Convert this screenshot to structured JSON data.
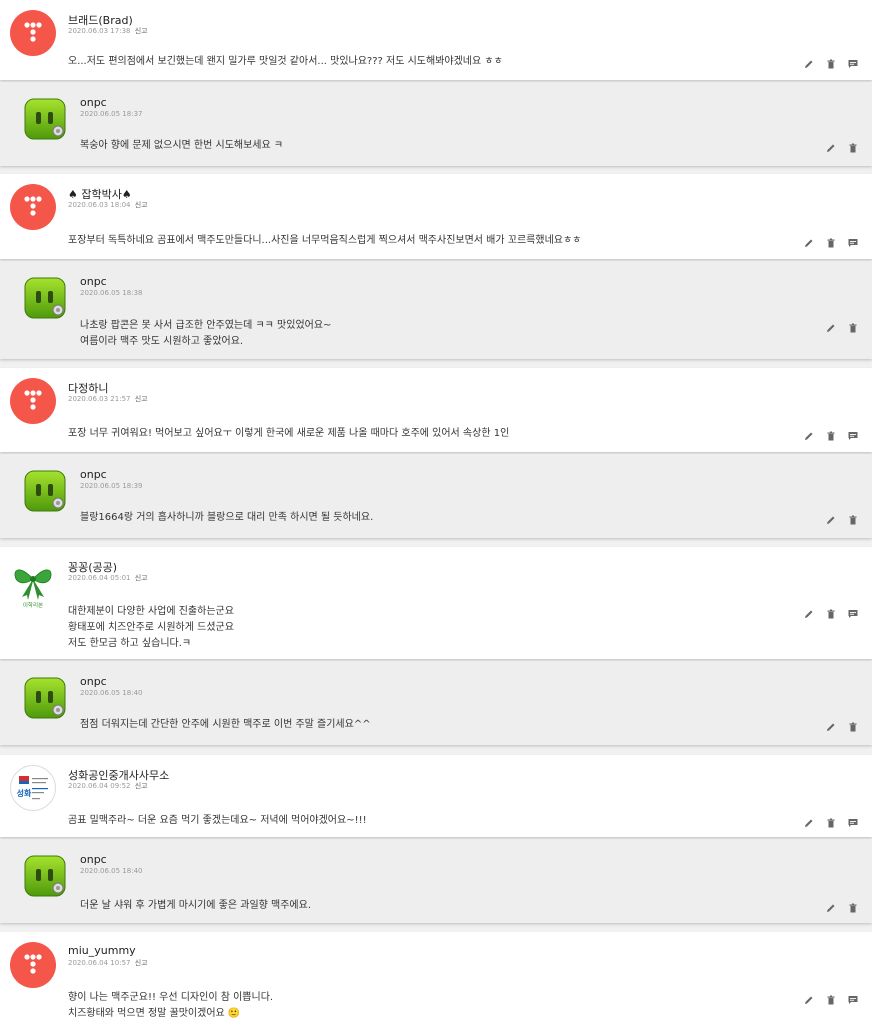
{
  "comments": [
    {
      "author": "브래드(Brad)",
      "date": "2020.06.03 17:38",
      "report": "신고",
      "avatar": "red-dots",
      "lines": [
        "오...저도 편의점에서 보긴했는데 왠지 밀가루 맛일것 같아서... 맛있나요??? 저도 시도해봐야겠네요 ㅎㅎ"
      ],
      "reply": {
        "author": "onpc",
        "date": "2020.06.05 18:37",
        "lines": [
          "복숭아 향에 문제 없으시면 한번 시도해보세요 ㅋ"
        ]
      }
    },
    {
      "author": "♠ 잡학박사♠",
      "date": "2020.06.03 18:04",
      "report": "신고",
      "avatar": "red-dots",
      "lines": [
        "포장부터 독특하네요 곰표에서 맥주도만들다니...사진을 너무먹음직스럽게 찍으셔서 맥주사진보면서 배가 꼬르륵했네요ㅎㅎ"
      ],
      "reply": {
        "author": "onpc",
        "date": "2020.06.05 18:38",
        "lines": [
          "나초랑 팝콘은 못 사서 급조한 안주였는데 ㅋㅋ 맛있었어요~",
          "여름이라 맥주 맛도 시원하고 좋았어요."
        ]
      }
    },
    {
      "author": "다정하니",
      "date": "2020.06.03 21:57",
      "report": "신고",
      "avatar": "red-dots",
      "lines": [
        "포장 너무 귀여워요! 먹어보고 싶어요ㅜ 이렇게 한국에 새로운 제품 나올 때마다 호주에 있어서 속상한 1인"
      ],
      "reply": {
        "author": "onpc",
        "date": "2020.06.05 18:39",
        "lines": [
          "블랑1664랑 거의 흡사하니까 블랑으로 대리 만족 하시면 될 듯하네요."
        ]
      }
    },
    {
      "author": "꽁꽁(공공)",
      "date": "2020.06.04 05:01",
      "report": "신고",
      "avatar": "ribbon",
      "avatar_caption": "이학리본",
      "lines": [
        "대한제분이 다양한 사업에 진출하는군요",
        "황태포에 치즈안주로 시원하게 드셨군요",
        "저도 한모금 하고 싶습니다.ㅋ"
      ],
      "reply": {
        "author": "onpc",
        "date": "2020.06.05 18:40",
        "lines": [
          "점점 더워지는데 간단한 안주에 시원한 맥주로 이번 주말 즐기세요^^"
        ]
      }
    },
    {
      "author": "성화공인중개사사무소",
      "date": "2020.06.04 09:52",
      "report": "신고",
      "avatar": "seonghwa",
      "avatar_caption": "성화",
      "lines": [
        "곰표 밀맥주라~ 더운 요즘 먹기 좋겠는데요~ 저녁에 먹어야겠어요~!!!"
      ],
      "reply": {
        "author": "onpc",
        "date": "2020.06.05 18:40",
        "lines": [
          "더운 날 샤워 후 가볍게 마시기에 좋은 과일향 맥주에요."
        ]
      }
    },
    {
      "author": "miu_yummy",
      "date": "2020.06.04 10:57",
      "report": "신고",
      "avatar": "red-dots",
      "lines": [
        "향이 나는 맥주군요!! 우선 디자인이 참 이쁩니다.",
        "치즈황태와 먹으면 정말 꿀맛이겠어요 🙂"
      ],
      "reply": null
    }
  ]
}
